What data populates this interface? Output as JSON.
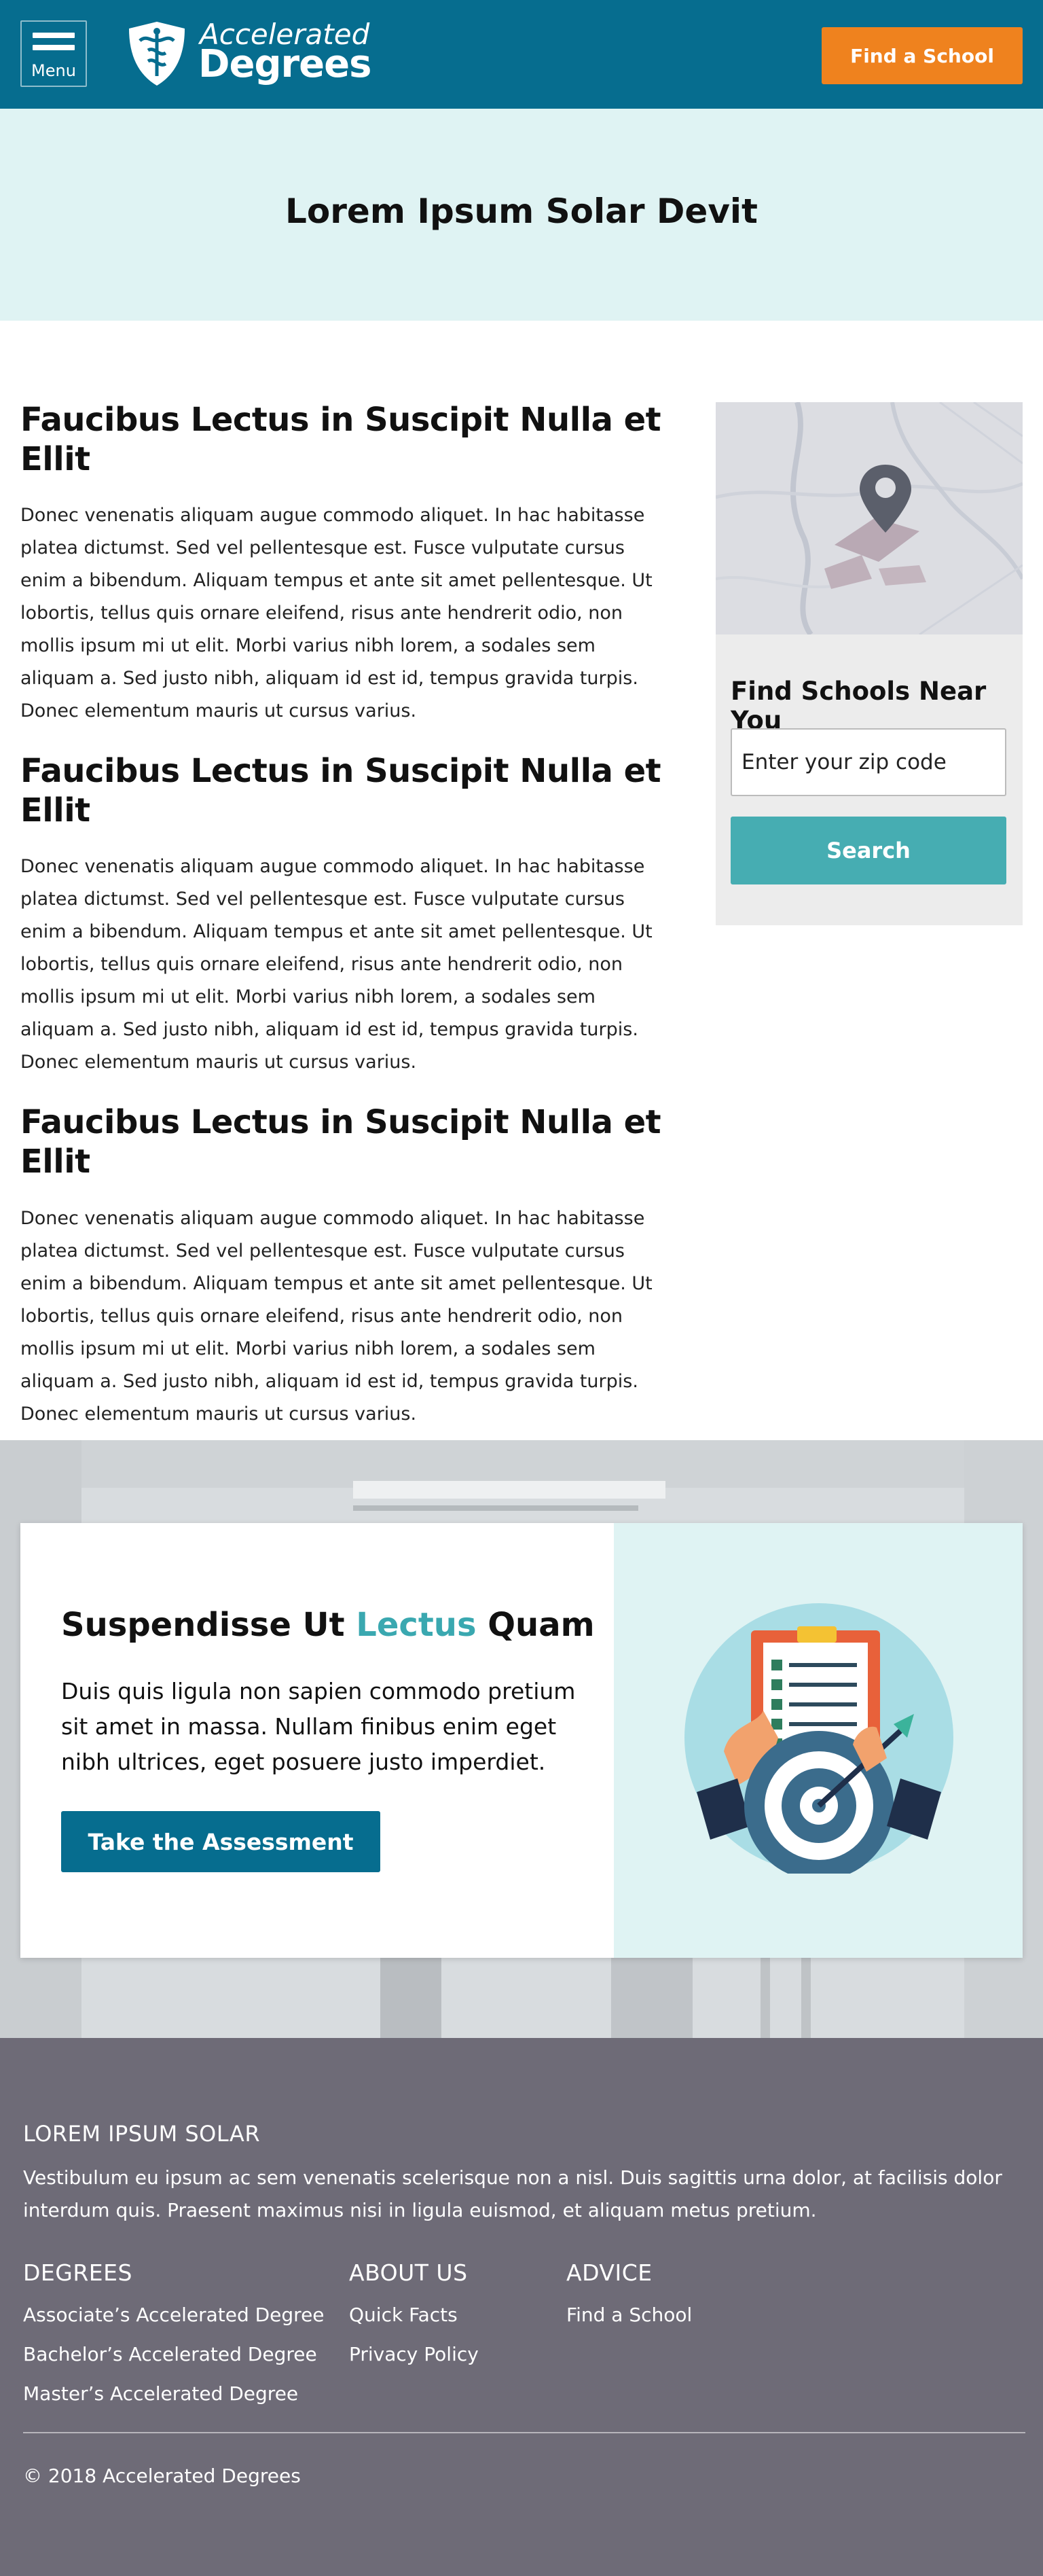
{
  "header": {
    "menu_label": "Menu",
    "logo_line1": "Accelerated",
    "logo_line2": "Degrees",
    "cta_label": "Find a School"
  },
  "hero": {
    "title": "Lorem Ipsum Solar Devit"
  },
  "article": {
    "sections": [
      {
        "heading": "Faucibus Lectus in Suscipit Nulla et Ellit",
        "body": "Donec venenatis aliquam augue commodo aliquet. In hac habitasse platea dictumst. Sed vel pellentesque est. Fusce vulputate cursus enim a bibendum. Aliquam tempus et ante sit amet pellentesque. Ut lobortis, tellus quis ornare eleifend, risus ante hendrerit odio, non mollis ipsum mi ut elit. Morbi varius nibh lorem, a sodales sem aliquam a. Sed justo nibh, aliquam id est id, tempus gravida turpis. Donec elementum mauris ut cursus varius."
      },
      {
        "heading": "Faucibus Lectus in Suscipit Nulla et Ellit",
        "body": "Donec venenatis aliquam augue commodo aliquet. In hac habitasse platea dictumst. Sed vel pellentesque est. Fusce vulputate cursus enim a bibendum. Aliquam tempus et ante sit amet pellentesque. Ut lobortis, tellus quis ornare eleifend, risus ante hendrerit odio, non mollis ipsum mi ut elit. Morbi varius nibh lorem, a sodales sem aliquam a. Sed justo nibh, aliquam id est id, tempus gravida turpis. Donec elementum mauris ut cursus varius."
      },
      {
        "heading": "Faucibus Lectus in Suscipit Nulla et Ellit",
        "body": "Donec venenatis aliquam augue commodo aliquet. In hac habitasse platea dictumst. Sed vel pellentesque est. Fusce vulputate cursus enim a bibendum. Aliquam tempus et ante sit amet pellentesque. Ut lobortis, tellus quis ornare eleifend, risus ante hendrerit odio, non mollis ipsum mi ut elit. Morbi varius nibh lorem, a sodales sem aliquam a. Sed justo nibh, aliquam id est id, tempus gravida turpis. Donec elementum mauris ut cursus varius."
      }
    ]
  },
  "sidebar": {
    "title": "Find Schools Near You",
    "zip_placeholder": "Enter your zip code",
    "search_label": "Search",
    "icon": "map-pin-icon"
  },
  "promo": {
    "title_before": "Suspendisse Ut ",
    "title_accent": "Lectus",
    "title_after": " Quam",
    "text": "Duis quis ligula non sapien commodo pretium sit amet in massa. Nullam finibus enim eget nibh ultrices, eget posuere justo imperdiet.",
    "button_label": "Take the Assessment",
    "illustration": "checklist-target-icon"
  },
  "footer": {
    "brand": "LOREM IPSUM SOLAR",
    "about": "Vestibulum eu ipsum ac sem venenatis scelerisque non a nisl. Duis sagittis urna dolor, at facilisis dolor interdum quis. Praesent maximus nisi in ligula euismod, et aliquam metus pretium.",
    "columns": [
      {
        "heading": "DEGREES",
        "links": [
          "Associate’s Accelerated Degree",
          "Bachelor’s Accelerated Degree",
          "Master’s Accelerated Degree"
        ]
      },
      {
        "heading": "ABOUT US",
        "links": [
          "Quick Facts",
          "Privacy Policy"
        ]
      },
      {
        "heading": "ADVICE",
        "links": [
          "Find a School"
        ]
      }
    ],
    "copyright": "© 2018 Accelerated Degrees"
  },
  "colors": {
    "header_bg": "#066d8f",
    "cta_orange": "#ef821e",
    "hero_bg": "#dff3f3",
    "teal_button": "#46adb2",
    "accent_text": "#3aa8b0",
    "footer_bg": "#6e6b77"
  }
}
